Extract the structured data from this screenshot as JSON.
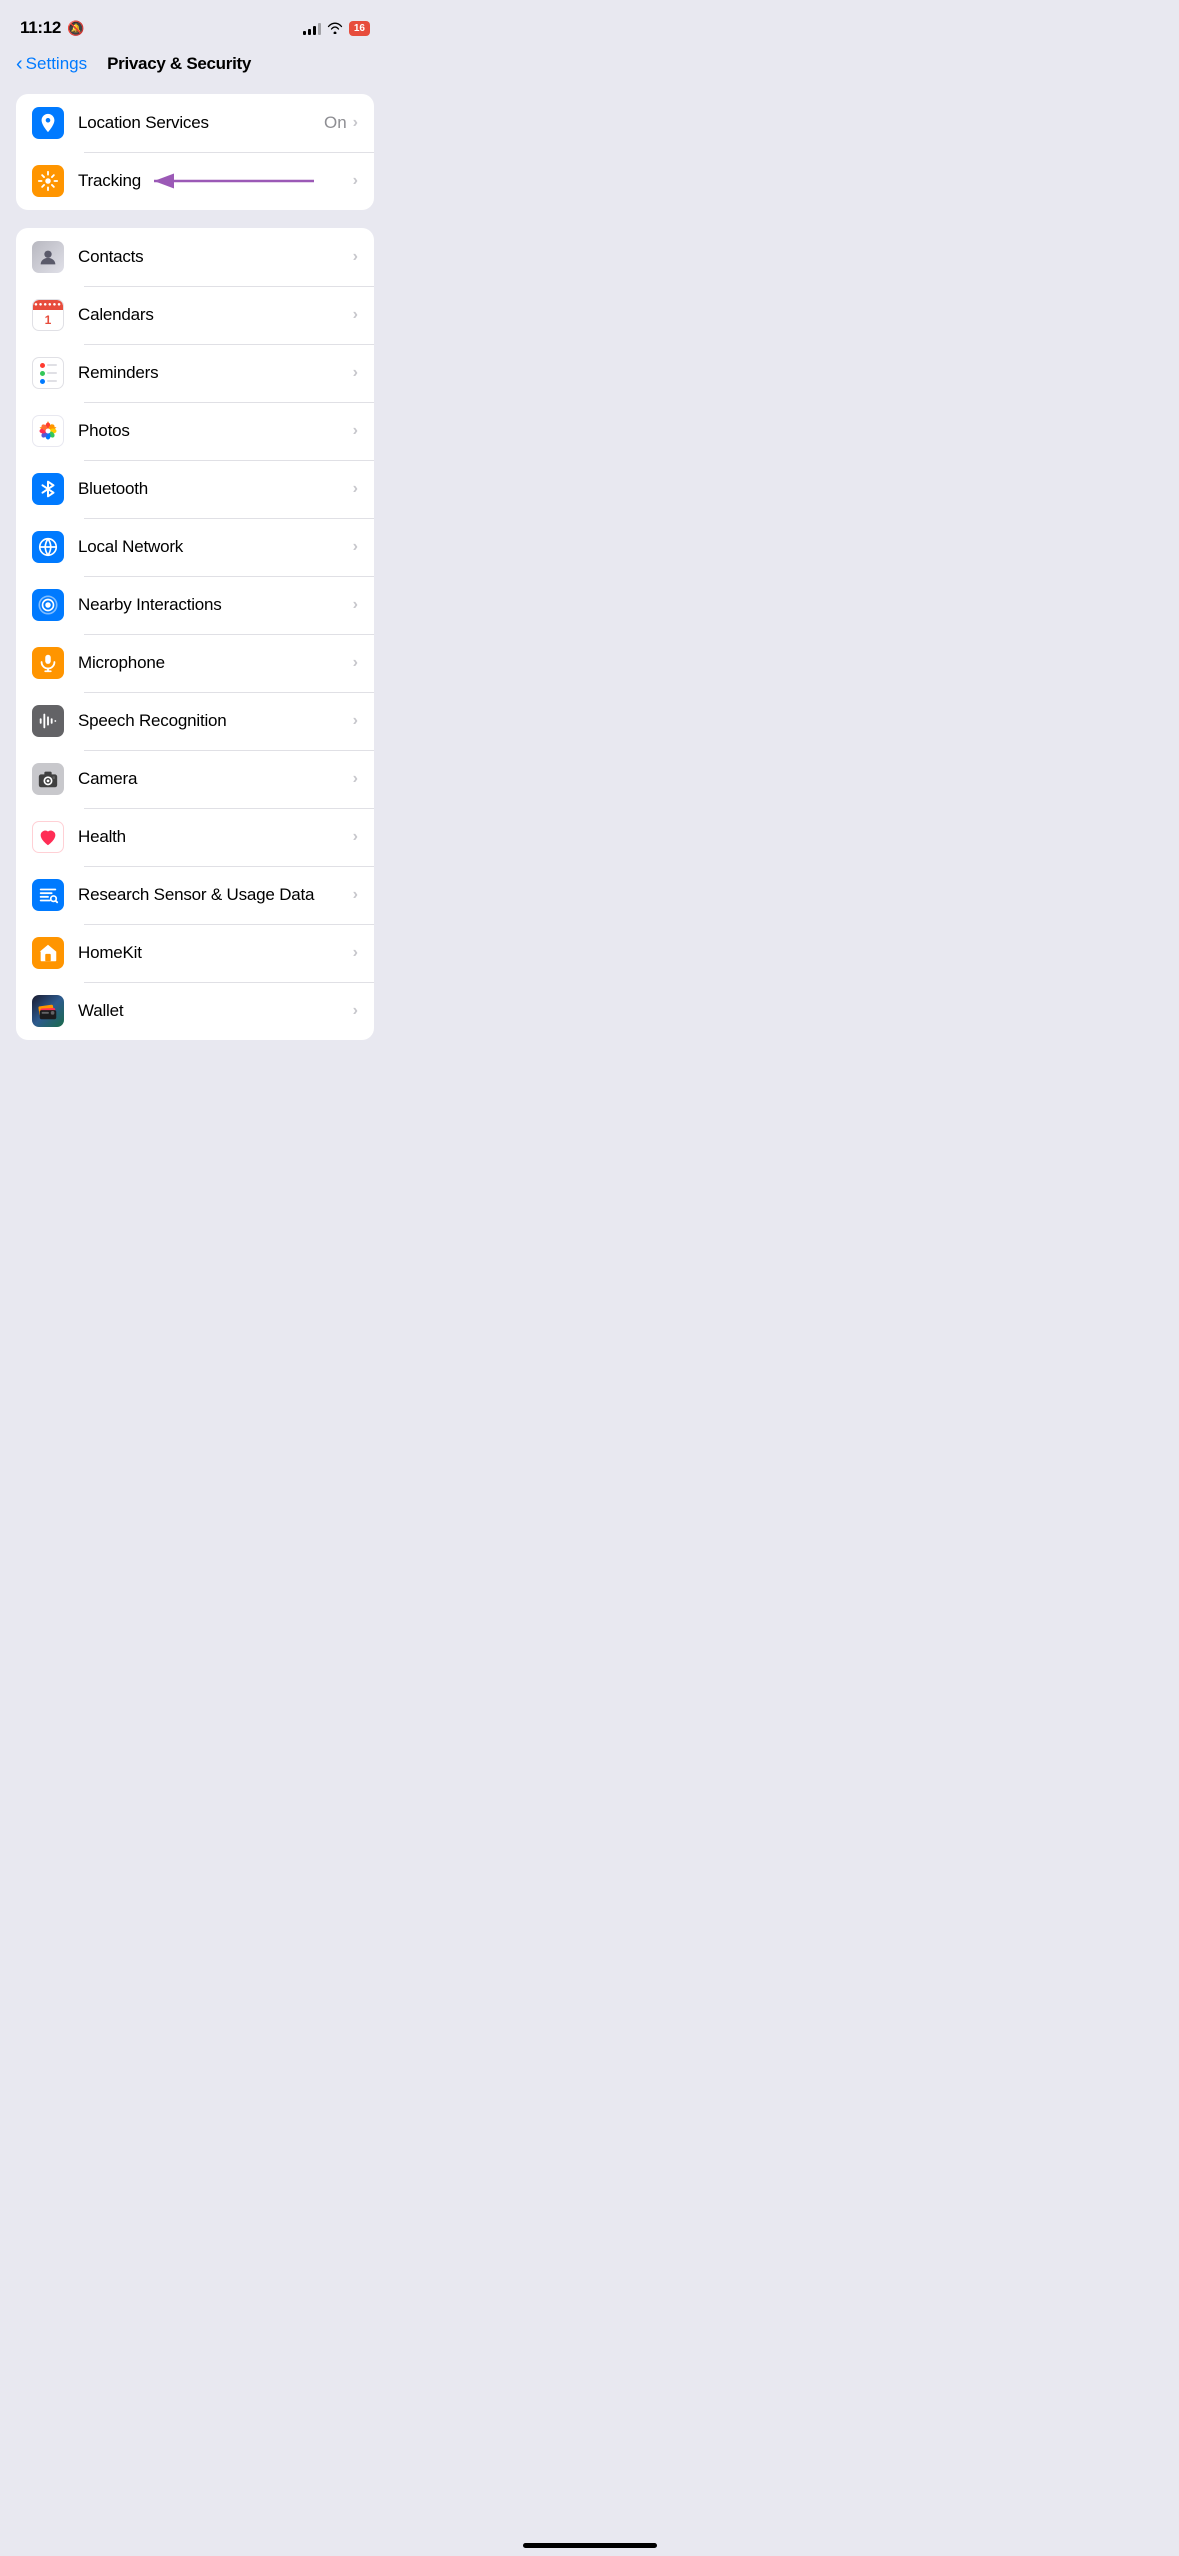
{
  "statusBar": {
    "time": "11:12",
    "batteryLevel": "16"
  },
  "navigation": {
    "backLabel": "Settings",
    "title": "Privacy & Security"
  },
  "topSection": {
    "rows": [
      {
        "id": "location-services",
        "label": "Location Services",
        "value": "On",
        "iconColor": "#007aff",
        "iconType": "location"
      },
      {
        "id": "tracking",
        "label": "Tracking",
        "value": "",
        "iconColor": "#ff9500",
        "iconType": "tracking"
      }
    ]
  },
  "mainSection": {
    "rows": [
      {
        "id": "contacts",
        "label": "Contacts",
        "iconType": "contacts"
      },
      {
        "id": "calendars",
        "label": "Calendars",
        "iconType": "calendars"
      },
      {
        "id": "reminders",
        "label": "Reminders",
        "iconType": "reminders"
      },
      {
        "id": "photos",
        "label": "Photos",
        "iconType": "photos"
      },
      {
        "id": "bluetooth",
        "label": "Bluetooth",
        "iconType": "bluetooth",
        "iconColor": "#007aff"
      },
      {
        "id": "local-network",
        "label": "Local Network",
        "iconType": "localnetwork",
        "iconColor": "#007aff"
      },
      {
        "id": "nearby-interactions",
        "label": "Nearby Interactions",
        "iconType": "nearby",
        "iconColor": "#007aff"
      },
      {
        "id": "microphone",
        "label": "Microphone",
        "iconType": "microphone",
        "iconColor": "#ff9500"
      },
      {
        "id": "speech-recognition",
        "label": "Speech Recognition",
        "iconType": "speech",
        "iconColor": "#636366"
      },
      {
        "id": "camera",
        "label": "Camera",
        "iconType": "camera",
        "iconColor": "#c0c0c0"
      },
      {
        "id": "health",
        "label": "Health",
        "iconType": "health"
      },
      {
        "id": "research",
        "label": "Research Sensor & Usage Data",
        "iconType": "research",
        "iconColor": "#007aff"
      },
      {
        "id": "homekit",
        "label": "HomeKit",
        "iconType": "homekit",
        "iconColor": "#ff9500"
      },
      {
        "id": "wallet",
        "label": "Wallet",
        "iconType": "wallet"
      }
    ]
  }
}
